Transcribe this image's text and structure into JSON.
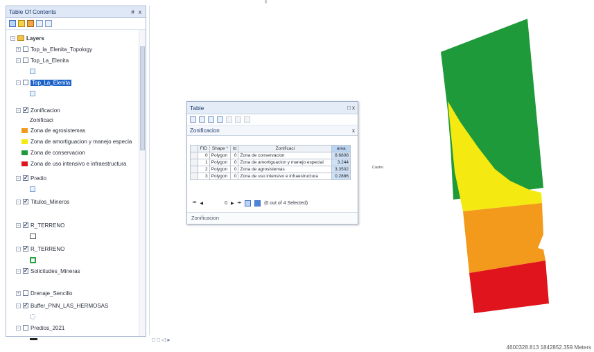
{
  "toc": {
    "title": "Table Of Contents",
    "pin": "# x",
    "root": "Layers",
    "layers": [
      {
        "label": "Top_la_Elenita_Topology",
        "checked": false
      },
      {
        "label": "Top_La_Elenita",
        "checked": false
      },
      {
        "label": "Top_La_Elenita",
        "checked": false,
        "selected": true
      },
      {
        "label": "Zonificacion",
        "checked": true
      },
      {
        "label": "Predio",
        "checked": true
      },
      {
        "label": "Titulos_Mineros",
        "checked": true
      },
      {
        "label": "R_TERRENO",
        "checked": true
      },
      {
        "label": "R_TERRENO",
        "checked": true
      },
      {
        "label": "Solicitudes_Mineras",
        "checked": true
      },
      {
        "label": "Drenaje_Sencillo",
        "checked": false
      },
      {
        "label": "Buffer_PNN_LAS_HERMOSAS",
        "checked": true
      },
      {
        "label": "Predios_2021",
        "checked": false
      }
    ],
    "zonificacion_field": "Zonificaci",
    "legend": [
      {
        "label": "Zona de agrosistemas",
        "color": "#f39a1c"
      },
      {
        "label": "Zona de amortiguacion y manejo especia",
        "color": "#f4ea12"
      },
      {
        "label": "Zona de conservacion",
        "color": "#1f9a3a"
      },
      {
        "label": "Zona de uso intensivo e infraestructura",
        "color": "#e0141c"
      }
    ]
  },
  "table_window": {
    "title": "Table",
    "controls": "□ x",
    "tab": "Zonificacion",
    "tab_close": "x",
    "columns": [
      "FID",
      "Shape *",
      "Id",
      "Zonificaci",
      "area"
    ],
    "rows": [
      [
        "0",
        "Polygon",
        "0",
        "Zona de conservacion",
        "8.6808"
      ],
      [
        "1",
        "Polygon",
        "0",
        "Zona de amortiguacion y manejo especial",
        "3.244"
      ],
      [
        "2",
        "Polygon",
        "0",
        "Zona de agrosistemas",
        "3.3502"
      ],
      [
        "3",
        "Polygon",
        "0",
        "Zona de uso intensivo e infraestructura",
        "0.2886"
      ]
    ],
    "nav_record": "0",
    "selection_status": "(0 out of 4 Selected)",
    "footer_tab": "Zonificacion"
  },
  "map": {
    "label": "Castro",
    "zone_colors": {
      "conservacion": "#1f9a3a",
      "amortiguacion": "#f4ea12",
      "agrosistemas": "#f39a1c",
      "uso_intensivo": "#e0141c"
    }
  },
  "status_bar": {
    "left": "□ □ ◁ ▸",
    "coordinates": "4600328.813  1842852.359 Meters"
  }
}
